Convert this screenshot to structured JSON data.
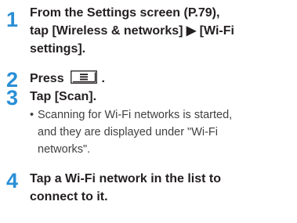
{
  "steps": [
    {
      "number": "1",
      "lines": [
        "From the Settings screen (P.79),",
        "tap [Wireless & networks] ▶ [Wi-Fi",
        "settings]."
      ]
    },
    {
      "number": "2",
      "text_before_key": "Press",
      "key_icon": "menu-key-icon",
      "text_after_key": "."
    },
    {
      "number": "3",
      "lines": [
        "Tap [Scan]."
      ],
      "bullet": "•",
      "note_lines": [
        "Scanning for Wi-Fi networks is started,",
        "and they are displayed under \"Wi-Fi",
        "networks\"."
      ]
    },
    {
      "number": "4",
      "lines": [
        "Tap a Wi-Fi network in the list to",
        "connect to it."
      ]
    }
  ],
  "colors": {
    "step_number": "#2a8fd6",
    "text": "#231f20",
    "note_text": "#414042"
  }
}
